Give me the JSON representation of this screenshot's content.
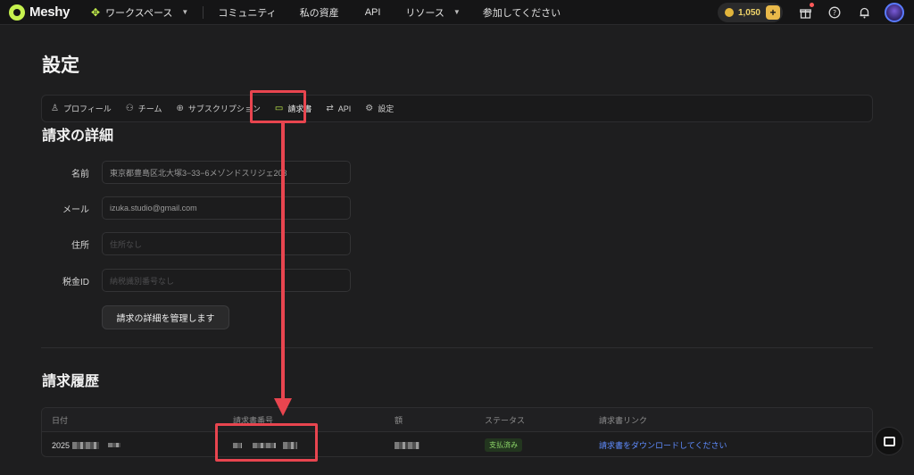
{
  "topbar": {
    "brand": "Meshy",
    "workspace_label": "ワークスペース",
    "nav_items": [
      "コミュニティ",
      "私の資産",
      "API",
      "リソース",
      "参加してください"
    ],
    "credits": "1,050",
    "plus_label": "+"
  },
  "page": {
    "title": "設定"
  },
  "tabs": [
    {
      "label": "プロフィール",
      "icon": "user-icon",
      "glyph": "♙"
    },
    {
      "label": "チーム",
      "icon": "team-icon",
      "glyph": "⚇"
    },
    {
      "label": "サブスクリプション",
      "icon": "plus-circle-icon",
      "glyph": "⊕"
    },
    {
      "label": "請求書",
      "icon": "invoice-icon",
      "glyph": "▭"
    },
    {
      "label": "API",
      "icon": "api-icon",
      "glyph": "⇄"
    },
    {
      "label": "設定",
      "icon": "gear-icon",
      "glyph": "⚙"
    }
  ],
  "billing": {
    "heading": "請求の詳細",
    "fields": [
      {
        "label": "名前",
        "value": "東京都豊島区北大塚3−33−6メゾンドスリジェ203",
        "placeholder": ""
      },
      {
        "label": "メール",
        "value": "izuka.studio@gmail.com",
        "placeholder": ""
      },
      {
        "label": "住所",
        "value": "",
        "placeholder": "住所なし"
      },
      {
        "label": "税金ID",
        "value": "",
        "placeholder": "納税識別番号なし"
      }
    ],
    "manage_button": "請求の詳細を管理します"
  },
  "history": {
    "heading": "請求履歴",
    "columns": [
      "日付",
      "請求書番号",
      "額",
      "ステータス",
      "請求書リンク"
    ],
    "rows": [
      {
        "date": "2025",
        "invoice_no": "",
        "amount": "",
        "status": "支払済み",
        "link": "請求書をダウンロードしてください"
      }
    ]
  },
  "colors": {
    "accent": "#c6f24e",
    "annotation": "#e8454f",
    "link": "#5f8cff"
  }
}
